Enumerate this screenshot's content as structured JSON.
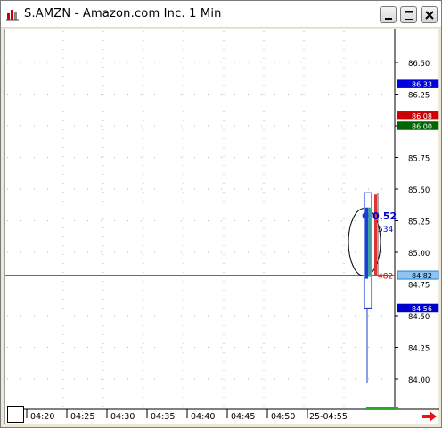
{
  "window": {
    "title": "S.AMZN - Amazon.com Inc. 1 Min",
    "buttons": [
      "minimize",
      "maximize",
      "close"
    ]
  },
  "icons": {
    "app": "chart-app-icon",
    "minimize": "minimize-icon",
    "maximize": "maximize-icon",
    "close": "close-icon",
    "scroll_right": "arrow-right-icon"
  },
  "colors": {
    "bid_marker": "#0000dd",
    "ask_marker": "#cc0000",
    "green_marker": "#006600",
    "last_price_marker": "#1e7fd9",
    "low_marker": "#0000cc",
    "price_line": "#1e7fd9",
    "candle_blue": "#1a3fd6",
    "candle_teal": "#47a0a0",
    "candle_red": "#d33",
    "volume_bar": "#22aa22"
  },
  "chart_data": {
    "type": "candlestick",
    "y_ticks": [
      "86.50",
      "86.25",
      "86.00",
      "85.75",
      "85.50",
      "85.25",
      "85.00",
      "84.75",
      "84.50",
      "84.25",
      "84.00"
    ],
    "y_tick_values": [
      86.5,
      86.25,
      86.0,
      85.75,
      85.5,
      85.25,
      85.0,
      84.75,
      84.5,
      84.25,
      84.0
    ],
    "ylim": [
      83.9,
      86.7
    ],
    "x_ticks": [
      "04:20",
      "04:25",
      "04:30",
      "04:35",
      "04:40",
      "04:45",
      "04:50",
      "25-04:55"
    ],
    "price_markers": [
      {
        "label": "86.33",
        "value": 86.33,
        "color": "#0000dd",
        "text_color": "#ffffff"
      },
      {
        "label": "86.08",
        "value": 86.08,
        "color": "#cc0000",
        "text_color": "#ffffff"
      },
      {
        "label": "86.00",
        "value": 86.0,
        "color": "#006600",
        "text_color": "#ffffff"
      },
      {
        "label": "84.82",
        "value": 84.82,
        "color": "#1e7fd9",
        "text_color": "#000000"
      },
      {
        "label": "84.56",
        "value": 84.56,
        "color": "#0000cc",
        "text_color": "#ffffff"
      }
    ],
    "last_price": 84.82,
    "annotations": [
      {
        "text": "0.52",
        "value": 85.29,
        "color": "#0000cc"
      },
      {
        "text": "534",
        "value": 85.19,
        "color": "#0000cc"
      },
      {
        "text": "482",
        "value": 84.82,
        "color": "#cc0000"
      }
    ],
    "bars": [
      {
        "time": "25-04:55",
        "open": 84.56,
        "high": 85.47,
        "low": 83.97,
        "close": 85.34
      }
    ],
    "grid": true
  }
}
